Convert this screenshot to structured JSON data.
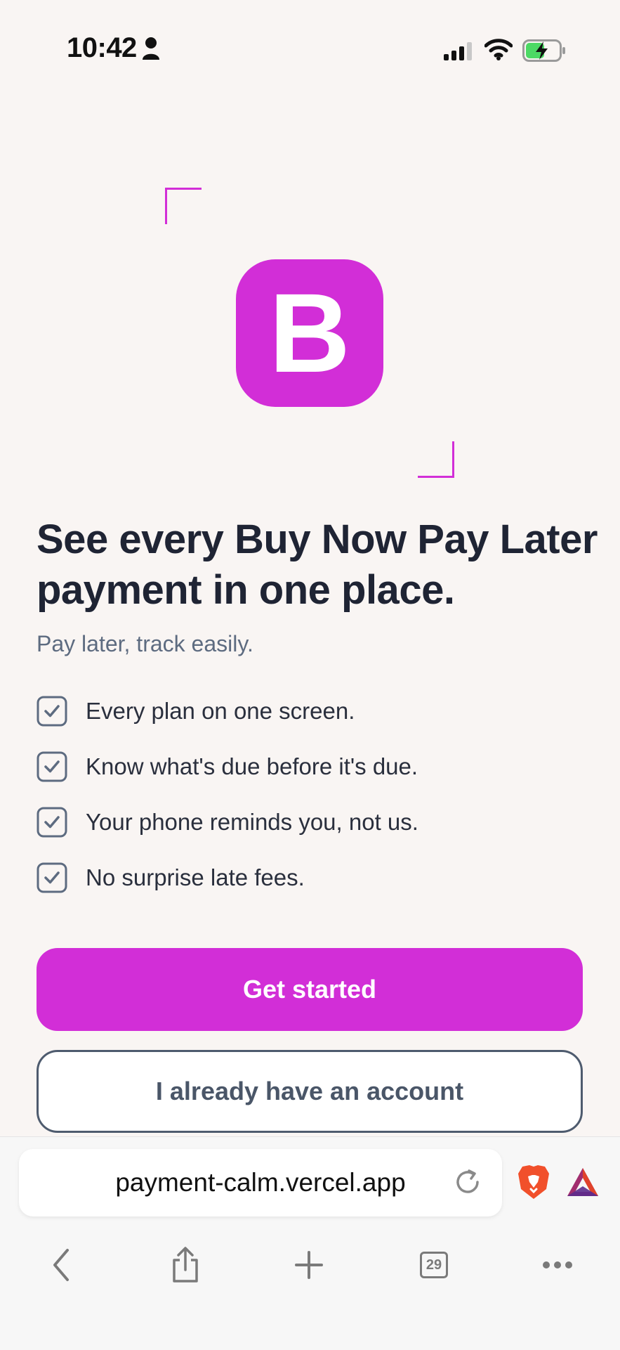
{
  "status_bar": {
    "time": "10:42"
  },
  "logo": {
    "letter": "B",
    "color": "#d22ed7"
  },
  "hero": {
    "headline": "See every Buy Now Pay Later payment in one place.",
    "subtitle": "Pay later, track easily."
  },
  "features": [
    {
      "text": "Every plan on one screen.",
      "icon": "check-icon"
    },
    {
      "text": "Know what's due before it's due.",
      "icon": "check-icon"
    },
    {
      "text": "Your phone reminds you, not us.",
      "icon": "check-icon"
    },
    {
      "text": "No surprise late fees.",
      "icon": "check-icon"
    }
  ],
  "actions": {
    "primary_label": "Get started",
    "secondary_label": "I already have an account"
  },
  "browser": {
    "url": "payment-calm.vercel.app",
    "tab_count": "29"
  },
  "colors": {
    "accent": "#d22ed7",
    "background": "#f9f5f3",
    "heading": "#1f2434",
    "muted": "#5d6b80"
  }
}
